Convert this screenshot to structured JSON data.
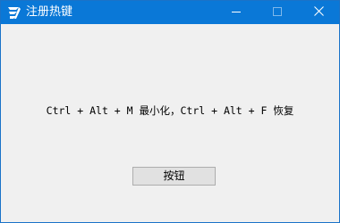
{
  "window": {
    "title": "注册热键",
    "app_icon": "app-logo-icon",
    "controls": {
      "minimize_icon": "minimize-icon",
      "maximize_icon": "maximize-icon",
      "close_icon": "close-icon"
    }
  },
  "content": {
    "hint_text": "Ctrl + Alt + M 最小化，Ctrl + Alt + F 恢复",
    "button_label": "按钮"
  },
  "colors": {
    "titlebar": "#0a78d7",
    "client_background": "#f0f0f0",
    "button_face": "#e1e1e1",
    "button_border": "#adadad"
  }
}
